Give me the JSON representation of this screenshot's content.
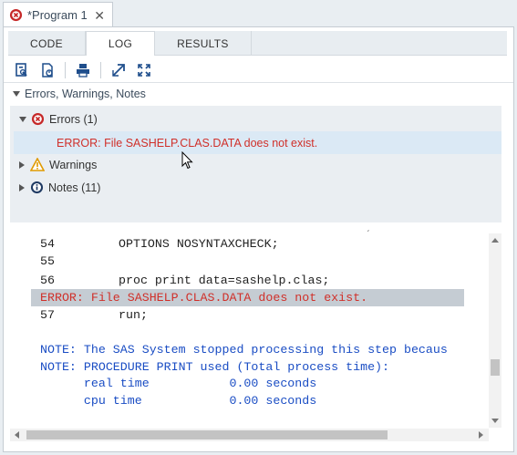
{
  "document_tab": {
    "label": "*Program 1",
    "close": "✕"
  },
  "subtabs": [
    "CODE",
    "LOG",
    "RESULTS"
  ],
  "active_subtab": "LOG",
  "section": {
    "title": "Errors, Warnings, Notes"
  },
  "tree": {
    "errors": {
      "label": "Errors (1)",
      "expanded": true,
      "items": [
        "ERROR: File SASHELP.CLAS.DATA does not exist."
      ]
    },
    "warnings": {
      "label": "Warnings",
      "expanded": false
    },
    "notes": {
      "label": "Notes (11)",
      "expanded": false
    }
  },
  "log_lines": [
    {
      "num": "54",
      "text": "OPTIONS NOSYNTAXCHECK;",
      "kind": "code"
    },
    {
      "num": "55",
      "text": "",
      "kind": "code"
    },
    {
      "num": "56",
      "text": "proc print data=sashelp.clas;",
      "kind": "code"
    },
    {
      "num": "",
      "text": "ERROR: File SASHELP.CLAS.DATA does not exist.",
      "kind": "error"
    },
    {
      "num": "57",
      "text": "run;",
      "kind": "code"
    },
    {
      "num": "",
      "text": "",
      "kind": "blank"
    },
    {
      "num": "",
      "text": "NOTE: The SAS System stopped processing this step becaus",
      "kind": "note"
    },
    {
      "num": "",
      "text": "NOTE: PROCEDURE PRINT used (Total process time):",
      "kind": "note"
    },
    {
      "num": "",
      "text": "      real time           0.00 seconds",
      "kind": "note"
    },
    {
      "num": "",
      "text": "      cpu time            0.00 seconds",
      "kind": "note"
    }
  ],
  "colors": {
    "error": "#d0302a",
    "note": "#1a4dc4",
    "highlight": "#dbe9f5"
  }
}
